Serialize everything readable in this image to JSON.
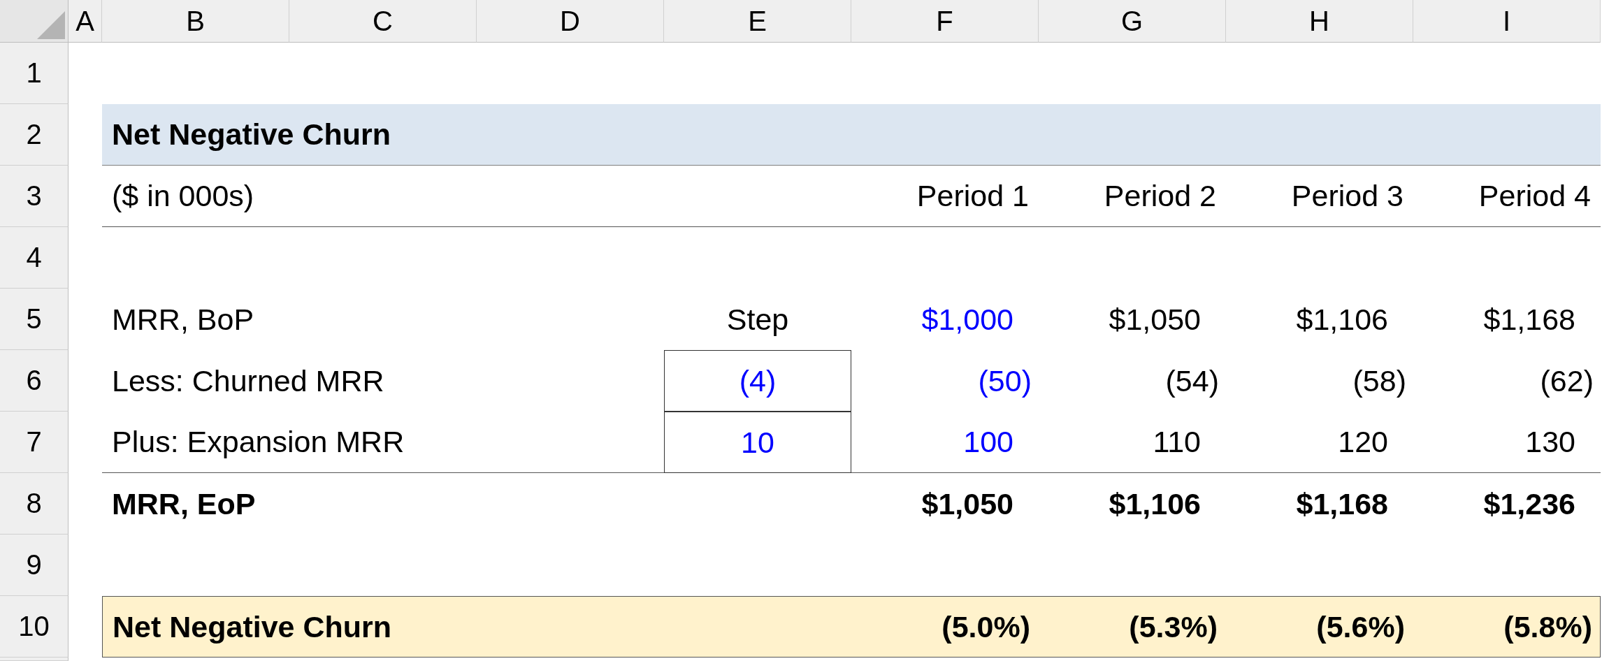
{
  "column_headers": [
    "A",
    "B",
    "C",
    "D",
    "E",
    "F",
    "G",
    "H",
    "I"
  ],
  "row_numbers": [
    "1",
    "2",
    "3",
    "4",
    "5",
    "6",
    "7",
    "8",
    "9",
    "10"
  ],
  "title": "Net Negative Churn",
  "units": "($ in 000s)",
  "periods": [
    "Period 1",
    "Period 2",
    "Period 3",
    "Period 4"
  ],
  "rows": [
    {
      "kind": "amount",
      "label": "MRR, BoP",
      "step": {
        "text": "Step",
        "kind": "label"
      },
      "values": [
        {
          "text": "$1,000",
          "kind": "input"
        },
        {
          "text": "$1,050",
          "kind": "formula"
        },
        {
          "text": "$1,106",
          "kind": "formula"
        },
        {
          "text": "$1,168",
          "kind": "formula"
        }
      ]
    },
    {
      "kind": "deduction",
      "label": "Less: Churned MRR",
      "step": {
        "text": "(4)",
        "kind": "input"
      },
      "values": [
        {
          "text": "(50)",
          "kind": "input"
        },
        {
          "text": "(54)",
          "kind": "formula"
        },
        {
          "text": "(58)",
          "kind": "formula"
        },
        {
          "text": "(62)",
          "kind": "formula"
        }
      ]
    },
    {
      "kind": "amount",
      "label": "Plus: Expansion MRR",
      "step": {
        "text": "10",
        "kind": "input"
      },
      "values": [
        {
          "text": "100",
          "kind": "input"
        },
        {
          "text": "110",
          "kind": "formula"
        },
        {
          "text": "120",
          "kind": "formula"
        },
        {
          "text": "130",
          "kind": "formula"
        }
      ]
    },
    {
      "kind": "total",
      "label": "MRR, EoP",
      "values": [
        {
          "text": "$1,050",
          "kind": "formula"
        },
        {
          "text": "$1,106",
          "kind": "formula"
        },
        {
          "text": "$1,168",
          "kind": "formula"
        },
        {
          "text": "$1,236",
          "kind": "formula"
        }
      ]
    }
  ],
  "summary": {
    "label": "Net Negative Churn",
    "values": [
      "(5.0%)",
      "(5.3%)",
      "(5.6%)",
      "(5.8%)"
    ]
  }
}
